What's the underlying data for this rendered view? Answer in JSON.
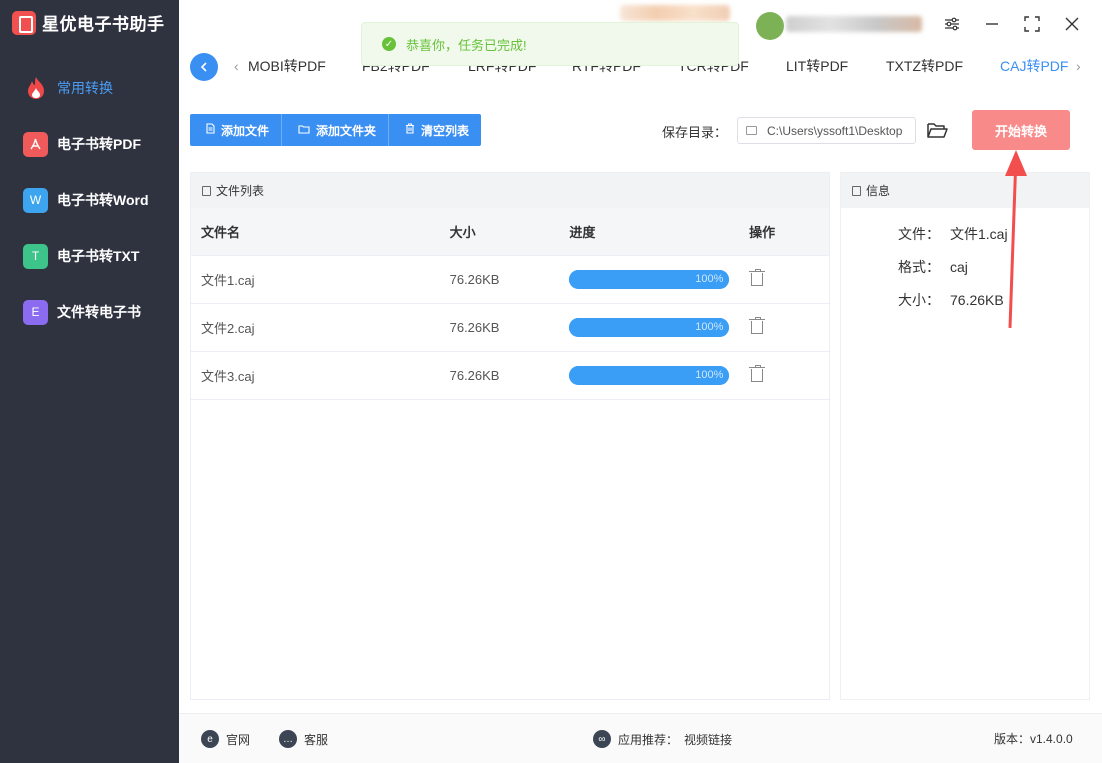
{
  "app": {
    "name": "星优电子书助手"
  },
  "sidebar": {
    "items": [
      {
        "label": "常用转换",
        "icon": "flame-icon",
        "active": true
      },
      {
        "label": "电子书转PDF",
        "icon": "pdf-icon",
        "badge": "⅄"
      },
      {
        "label": "电子书转Word",
        "icon": "word-icon",
        "badge": "W"
      },
      {
        "label": "电子书转TXT",
        "icon": "txt-icon",
        "badge": "T"
      },
      {
        "label": "文件转电子书",
        "icon": "ebook-icon",
        "badge": "E"
      }
    ]
  },
  "toast": {
    "message": "恭喜你，任务已完成!",
    "icon": "check-circle-icon",
    "color": "#67c23a"
  },
  "tabs": [
    {
      "label": "MOBI转PDF"
    },
    {
      "label": "FB2转PDF"
    },
    {
      "label": "LRF转PDF"
    },
    {
      "label": "RTF转PDF"
    },
    {
      "label": "TCR转PDF"
    },
    {
      "label": "LIT转PDF"
    },
    {
      "label": "TXTZ转PDF"
    },
    {
      "label": "CAJ转PDF",
      "active": true
    }
  ],
  "toolbar": {
    "add_file": "添加文件",
    "add_folder": "添加文件夹",
    "clear_list": "清空列表",
    "save_dir_label": "保存目录：",
    "save_dir_value": "C:\\Users\\yssoft1\\Desktop",
    "start_label": "开始转换"
  },
  "file_list": {
    "title": "文件列表",
    "columns": [
      "文件名",
      "大小",
      "进度",
      "操作"
    ],
    "rows": [
      {
        "name": "文件1.caj",
        "size": "76.26KB",
        "progress_percent": 100,
        "progress_text": "100%"
      },
      {
        "name": "文件2.caj",
        "size": "76.26KB",
        "progress_percent": 100,
        "progress_text": "100%"
      },
      {
        "name": "文件3.caj",
        "size": "76.26KB",
        "progress_percent": 100,
        "progress_text": "100%"
      }
    ]
  },
  "info": {
    "title": "信息",
    "file_label": "文件：",
    "file_value": "文件1.caj",
    "format_label": "格式：",
    "format_value": "caj",
    "size_label": "大小：",
    "size_value": "76.26KB"
  },
  "footer": {
    "website": "官网",
    "support": "客服",
    "recommend_label": "应用推荐：",
    "recommend_value": "视频链接",
    "version": "版本：v1.4.0.0"
  },
  "colors": {
    "accent": "#3a8ff2",
    "sidebar": "#2f3340",
    "start_button": "#f98a8a",
    "annotation_arrow": "#f24e4e"
  }
}
